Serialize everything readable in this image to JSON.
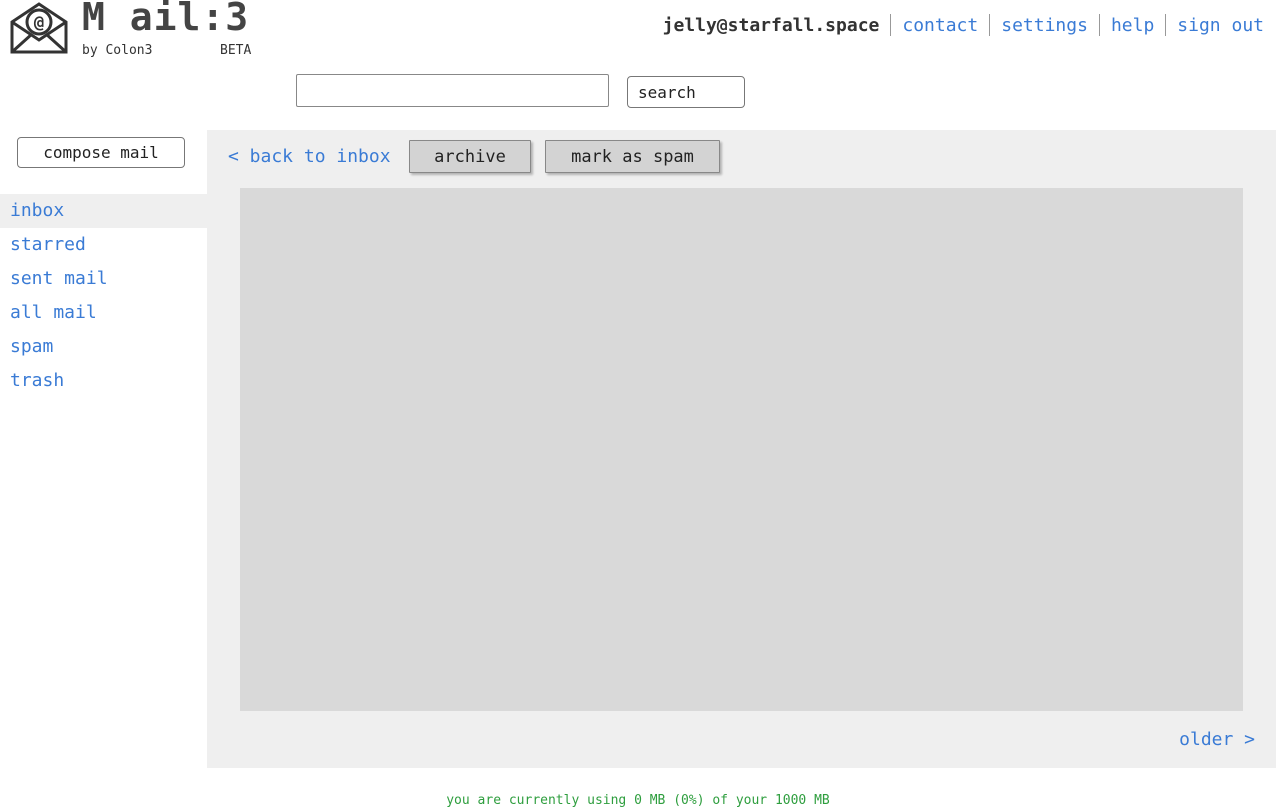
{
  "brand": {
    "logo_text": "M ail:3",
    "by_line": "by Colon3",
    "badge": "BETA"
  },
  "top_nav": {
    "user_email": "jelly@starfall.space",
    "links": [
      "contact",
      "settings",
      "help",
      "sign out"
    ]
  },
  "search": {
    "placeholder": "",
    "value": "",
    "button_label": "search"
  },
  "sidebar": {
    "compose_label": "compose mail",
    "items": [
      {
        "label": "inbox",
        "active": true
      },
      {
        "label": "starred",
        "active": false
      },
      {
        "label": "sent mail",
        "active": false
      },
      {
        "label": "all mail",
        "active": false
      },
      {
        "label": "spam",
        "active": false
      },
      {
        "label": "trash",
        "active": false
      }
    ]
  },
  "toolbar": {
    "back_label": "< back to inbox",
    "archive_label": "archive",
    "spam_label": "mark as spam"
  },
  "pagination": {
    "older_label": "older >"
  },
  "footer": {
    "storage_text": "you are currently using 0 MB (0%) of your 1000 MB"
  },
  "colors": {
    "link": "#3a7bd5",
    "footer_text": "#2e9e3e",
    "panel_bg": "#efefef",
    "message_bg": "#d9d9d9",
    "button_bg": "#d3d3d3"
  }
}
